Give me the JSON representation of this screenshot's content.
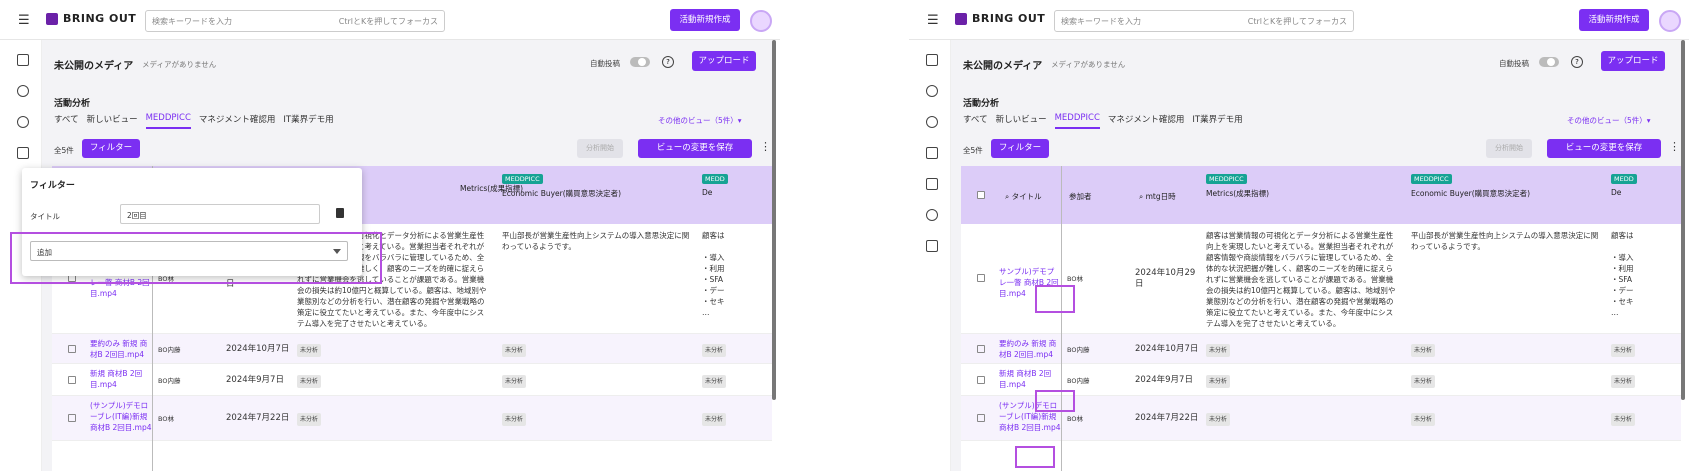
{
  "header": {
    "brand": "BRING OUT",
    "search_placeholder": "検索キーワードを入力",
    "search_hint": "CtrlとKを押してフォーカス",
    "new_button": "活動新規作成"
  },
  "media": {
    "title": "未公開のメディア",
    "subtitle": "メディアがありません",
    "autopost_label": "自動投稿",
    "help": "?",
    "upload_button": "アップロード"
  },
  "section": {
    "title": "活動分析"
  },
  "tabs": [
    "すべて",
    "新しいビュー",
    "MEDDPICC",
    "マネジメント確認用",
    "IT業界デモ用"
  ],
  "active_tab": "MEDDPICC",
  "other_views": "その他のビュー（5件）▾",
  "toolbar": {
    "count": "全5件",
    "filter_button": "フィルター",
    "analyze_button": "分析開始",
    "save_view_button": "ビューの変更を保存",
    "more": "⋮"
  },
  "table": {
    "headers": {
      "title": "タイトル",
      "participants": "参加者",
      "mtg_date": "mtg日時",
      "tag": "MEDDPICC",
      "metrics": "Metrics(成果指標)",
      "economic_buyer": "Economic Buyer(購買意思決定者)",
      "decision": "De",
      "tag_partial": "MEDD"
    },
    "rows": [
      {
        "title": "サンプル)デモプレ一瞥 商材B 2回目.mp4",
        "participant": "BO林",
        "date": "2024年10月29日",
        "metrics": "顧客は営業情報の可視化とデータ分析による営業生産性向上を実現したいと考えている。営業担当者それぞれが顧客情報や商談情報をバラバラに管理しているため、全体的な状況把握が難しく、顧客のニーズを的確に捉えられずに営業機会を逃していることが課題である。営業機会の損失は約10億円と概算している。顧客は、地域別や業態別などの分析を行い、潜在顧客の発掘や営業戦略の策定に役立てたいと考えている。また、今年度中にシステム導入を完了させたいと考えている。",
        "economic_buyer": "平山部長が営業生産性向上システムの導入意思決定に関わっているようです。",
        "decision": "顧客は"
      },
      {
        "title": "要約のみ 新規 商材B 2回目.mp4",
        "participant": "BO内藤",
        "date": "2024年10月7日",
        "metrics": "未分析",
        "economic_buyer": "未分析",
        "decision": "未分析"
      },
      {
        "title": "新規 商材B 2回目.mp4",
        "participant": "BO内藤",
        "date": "2024年9月7日",
        "metrics": "未分析",
        "economic_buyer": "未分析",
        "decision": "未分析"
      },
      {
        "title": "(サンプル)デモローブレ(IT編)新規 商材B 2回目.mp4",
        "participant": "BO林",
        "date": "2024年7月22日",
        "metrics": "未分析",
        "economic_buyer": "未分析",
        "decision": "未分析"
      }
    ],
    "decision_bullets": "・導入\n・利用\n・SFA\n・デー\n・セキ\n…"
  },
  "filter_panel": {
    "title": "フィルター",
    "field_label": "タイトル",
    "field_value": "2回目",
    "add_label": "追加"
  }
}
